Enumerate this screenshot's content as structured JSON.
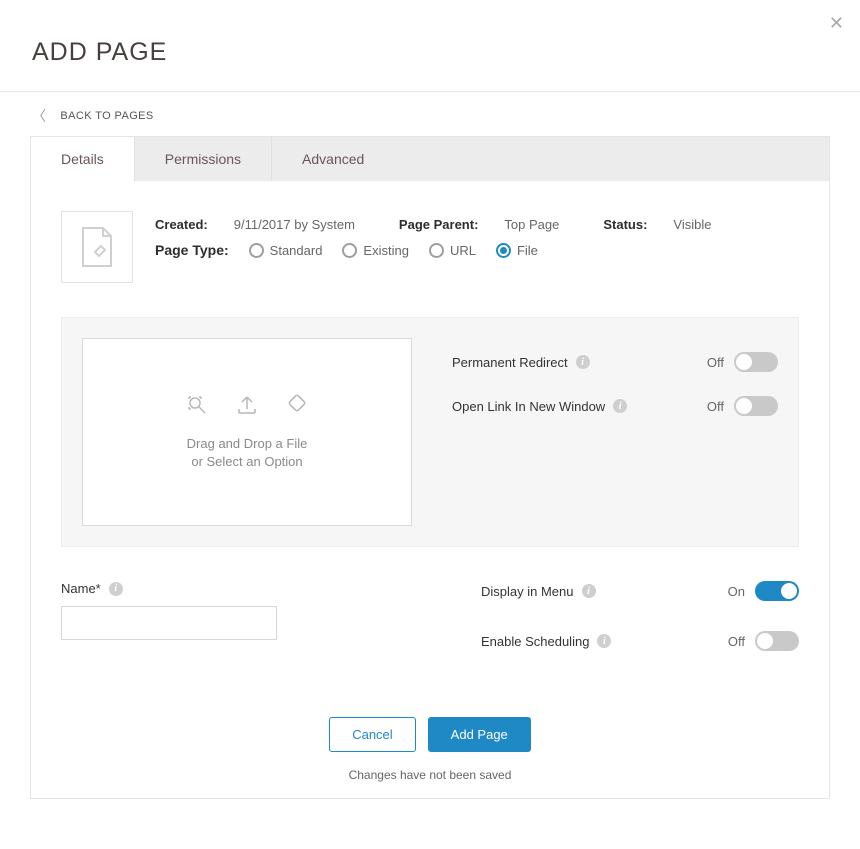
{
  "header": {
    "title": "ADD PAGE"
  },
  "back_link": "BACK TO PAGES",
  "tabs": [
    {
      "label": "Details",
      "active": true
    },
    {
      "label": "Permissions",
      "active": false
    },
    {
      "label": "Advanced",
      "active": false
    }
  ],
  "meta": {
    "created_label": "Created:",
    "created_value": "9/11/2017 by System",
    "parent_label": "Page Parent:",
    "parent_value": "Top Page",
    "status_label": "Status:",
    "status_value": "Visible",
    "type_label": "Page Type:",
    "types": [
      {
        "label": "Standard",
        "selected": false
      },
      {
        "label": "Existing",
        "selected": false
      },
      {
        "label": "URL",
        "selected": false
      },
      {
        "label": "File",
        "selected": true
      }
    ]
  },
  "dropzone": {
    "line1": "Drag and Drop a File",
    "line2": "or Select an Option"
  },
  "toggles_box": [
    {
      "label": "Permanent Redirect",
      "state": "Off",
      "on": false
    },
    {
      "label": "Open Link In New Window",
      "state": "Off",
      "on": false
    }
  ],
  "fields": {
    "name_label": "Name*",
    "name_value": ""
  },
  "toggles_main": [
    {
      "label": "Display in Menu",
      "state": "On",
      "on": true
    },
    {
      "label": "Enable Scheduling",
      "state": "Off",
      "on": false
    }
  ],
  "footer": {
    "cancel": "Cancel",
    "submit": "Add Page",
    "status": "Changes have not been saved"
  }
}
